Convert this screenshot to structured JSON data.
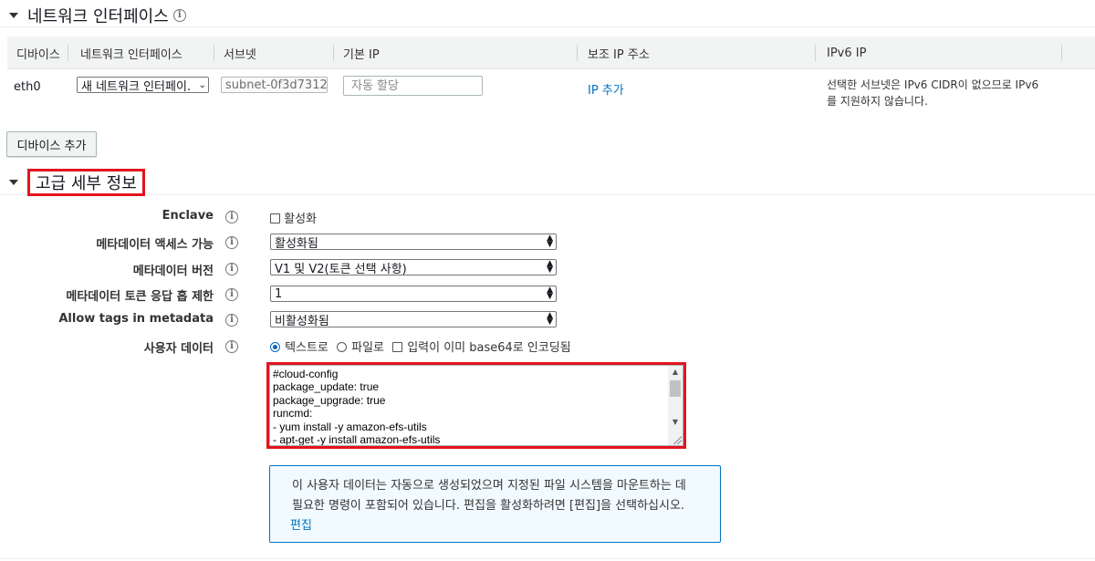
{
  "network_section": {
    "title": "네트워크 인터페이스",
    "table": {
      "headers": [
        "디바이스",
        "네트워크 인터페이스",
        "서브넷",
        "기본 IP",
        "보조 IP 주소",
        "IPv6 IP"
      ],
      "row": {
        "device": "eth0",
        "interface_select": "새 네트워크 인터페이.",
        "subnet_select": "subnet-0f3d7312",
        "primary_ip_placeholder": "자동 할당",
        "secondary_ip_link": "IP 추가",
        "ipv6_line1": "선택한 서브넷은 IPv6 CIDR이 없으므로 IPv6",
        "ipv6_line2": "를 지원하지 않습니다."
      }
    },
    "add_device_button": "디바이스 추가"
  },
  "advanced_section": {
    "title": "고급 세부 정보",
    "enclave": {
      "label": "Enclave",
      "checkbox_label": "활성화"
    },
    "metadata_access": {
      "label": "메타데이터 액세스 가능",
      "value": "활성화됨"
    },
    "metadata_version": {
      "label": "메타데이터 버전",
      "value": "V1 및 V2(토큰 선택 사항)"
    },
    "metadata_hop_limit": {
      "label": "메타데이터 토큰 응답 홉 제한",
      "value": "1"
    },
    "allow_tags": {
      "label": "Allow tags in metadata",
      "value": "비활성화됨"
    },
    "user_data": {
      "label": "사용자 데이터",
      "options": [
        "텍스트로",
        "파일로",
        "입력이 이미 base64로 인코딩됨"
      ],
      "content": "#cloud-config\npackage_update: true\npackage_upgrade: true\nruncmd:\n- yum install -y amazon-efs-utils\n- apt-get -y install amazon-efs-utils\n- yum install -y nfs-utils"
    },
    "notice": {
      "text_line1": "이 사용자 데이터는 자동으로 생성되었으며 지정된 파일 시스템을 마운트하는 데",
      "text_line2": "필요한 명령이 포함되어 있습니다. 편집을 활성화하려면 [편집]을 선택하십시오.",
      "edit_link": "편집"
    }
  },
  "colors": {
    "accent": "#0073bb",
    "highlight": "#e3141d"
  }
}
